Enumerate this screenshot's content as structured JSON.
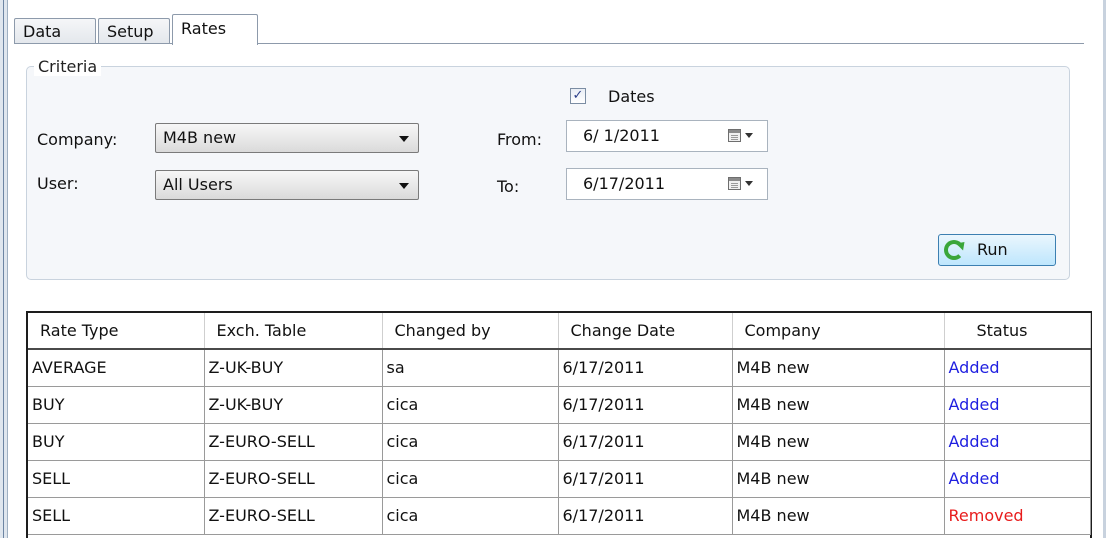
{
  "tabs": [
    {
      "label": "Data"
    },
    {
      "label": "Setup"
    },
    {
      "label": "Rates"
    }
  ],
  "criteria": {
    "legend": "Criteria",
    "company_label": "Company:",
    "company_value": "M4B new",
    "user_label": "User:",
    "user_value": "All Users",
    "dates_checked": true,
    "dates_check_mark": "✓",
    "dates_label": "Dates",
    "from_label": "From:",
    "from_value": "6/ 1/2011",
    "to_label": "To:",
    "to_value": "6/17/2011",
    "run_label": "Run"
  },
  "grid": {
    "headers": [
      "Rate Type",
      "Exch. Table",
      "Changed by",
      "Change Date",
      "Company",
      "Status"
    ],
    "rows": [
      [
        "AVERAGE",
        "Z-UK-BUY",
        "sa",
        "6/17/2011",
        "M4B new",
        "Added"
      ],
      [
        "BUY",
        "Z-UK-BUY",
        "cica",
        "6/17/2011",
        "M4B new",
        "Added"
      ],
      [
        "BUY",
        "Z-EURO-SELL",
        "cica",
        "6/17/2011",
        "M4B new",
        "Added"
      ],
      [
        "SELL",
        "Z-EURO-SELL",
        "cica",
        "6/17/2011",
        "M4B new",
        "Added"
      ],
      [
        "SELL",
        "Z-EURO-SELL",
        "cica",
        "6/17/2011",
        "M4B new",
        "Removed"
      ]
    ]
  },
  "colors": {
    "status_added": "#1f1fe0",
    "status_removed": "#e81c1c"
  }
}
